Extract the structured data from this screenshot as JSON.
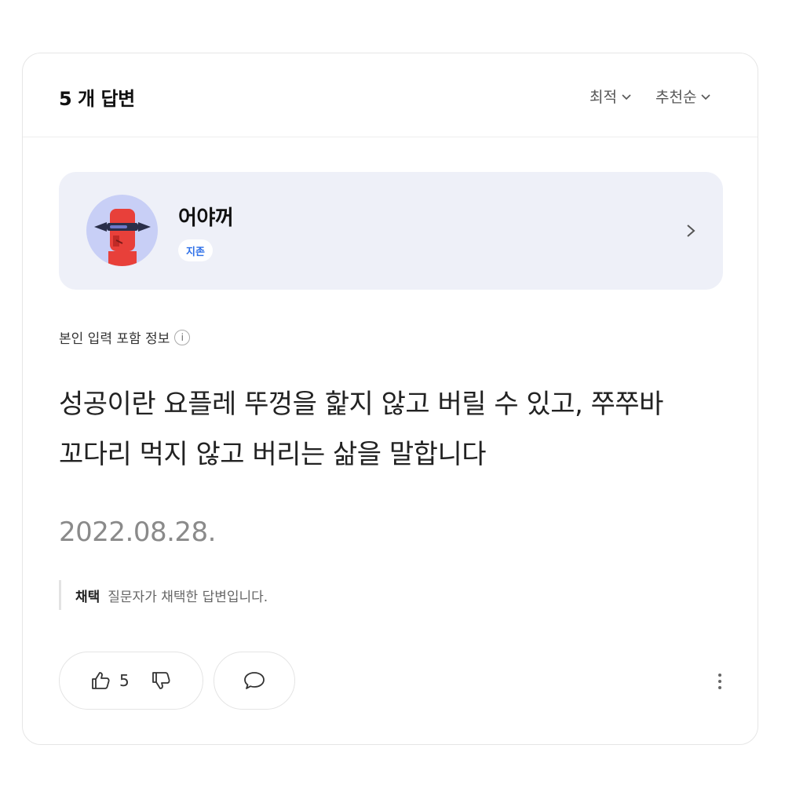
{
  "header": {
    "answer_count": "5 개 답변",
    "sort_best": "최적",
    "sort_recommend": "추천순"
  },
  "profile": {
    "username": "어야꺼",
    "badge": "지존"
  },
  "answer": {
    "info_label": "본인 입력 포함 정보",
    "info_icon": "i",
    "line1": "성공이란 요플레 뚜껑을 핥지 않고 버릴 수 있고, 쭈쭈바",
    "line2": "꼬다리 먹지 않고 버리는 삶을 말합니다",
    "date": "2022.08.28.",
    "adopt_label": "채택",
    "adopt_desc": "질문자가 채택한 답변입니다."
  },
  "actions": {
    "like_count": "5"
  },
  "colors": {
    "profile_bg": "#eef0f8",
    "badge_text": "#2d6fe8",
    "avatar_bg": "#c8cff6",
    "avatar_robot": "#e8403a"
  },
  "icons": [
    "chevron-down-icon",
    "chevron-right-icon",
    "info-icon",
    "thumbs-up-icon",
    "thumbs-down-icon",
    "comment-icon",
    "more-vertical-icon"
  ]
}
